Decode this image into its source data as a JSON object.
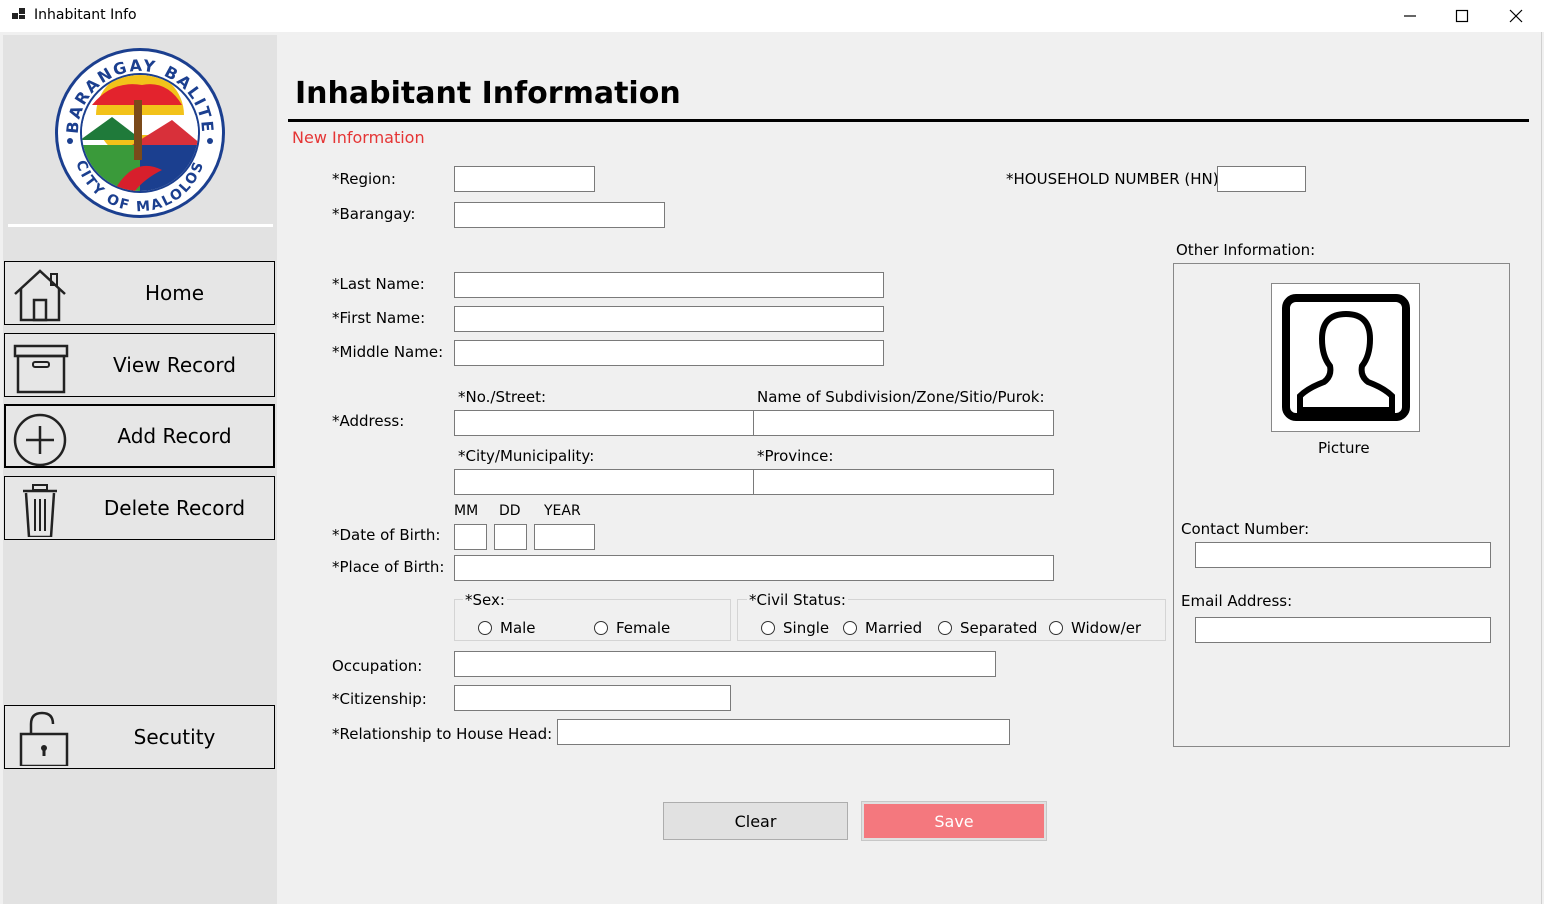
{
  "window": {
    "title": "Inhabitant Info",
    "controls": {
      "minimize": "—",
      "maximize": "☐",
      "close": "✕"
    }
  },
  "sidebar": {
    "logo": {
      "top_text": "BARANGAY BALITE",
      "bottom_text": "CITY OF MALOLOS"
    },
    "items": [
      {
        "label": "Home",
        "icon": "house-icon"
      },
      {
        "label": "View Record",
        "icon": "archive-box-icon"
      },
      {
        "label": "Add Record",
        "icon": "plus-circle-icon"
      },
      {
        "label": "Delete Record",
        "icon": "trash-icon"
      },
      {
        "label": "Secutity",
        "icon": "lock-icon"
      }
    ]
  },
  "form": {
    "title": "Inhabitant Information",
    "subtitle": "New Information",
    "subtitle_color": "#e53535",
    "labels": {
      "region": "*Region:",
      "barangay": "*Barangay:",
      "household": "*HOUSEHOLD NUMBER (HN):",
      "last_name": "*Last Name:",
      "first_name": "*First Name:",
      "middle_name": "*Middle Name:",
      "address": "*Address:",
      "street": "*No./Street:",
      "subdivision": "Name of Subdivision/Zone/Sitio/Purok:",
      "city": "*City/Municipality:",
      "province": "*Province:",
      "mm": "MM",
      "dd": "DD",
      "year": "YEAR",
      "dob": "*Date of Birth:",
      "pob": "*Place of Birth:",
      "sex": "*Sex:",
      "civil_status": "*Civil Status:",
      "occupation": "Occupation:",
      "citizenship": "*Citizenship:",
      "relationship": "*Relationship to House Head:"
    },
    "sex_options": [
      "Male",
      "Female"
    ],
    "civil_options": [
      "Single",
      "Married",
      "Separated",
      "Widow/er"
    ],
    "values": {
      "region": "",
      "barangay": "",
      "household": "",
      "last_name": "",
      "first_name": "",
      "middle_name": "",
      "street": "",
      "subdivision": "",
      "city": "",
      "province": "",
      "mm": "",
      "dd": "",
      "year": "",
      "pob": "",
      "occupation": "",
      "citizenship": "",
      "relationship": ""
    }
  },
  "other": {
    "title": "Other Information:",
    "picture_label": "Picture",
    "contact_label": "Contact Number:",
    "email_label": "Email Address:",
    "contact_value": "",
    "email_value": ""
  },
  "buttons": {
    "clear": "Clear",
    "save": "Save",
    "save_color": "#f4787e"
  }
}
